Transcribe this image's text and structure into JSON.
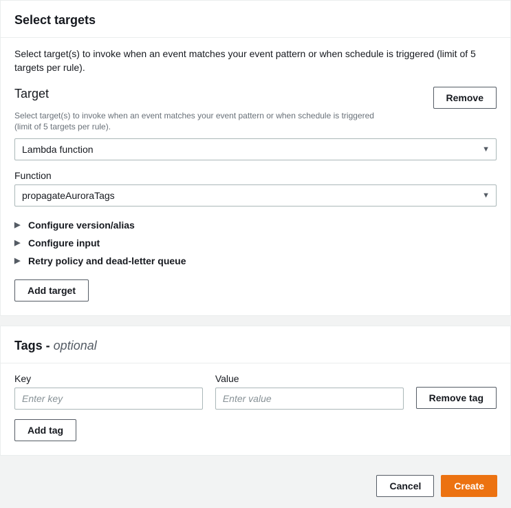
{
  "targets": {
    "panel_title": "Select targets",
    "intro": "Select target(s) to invoke when an event matches your event pattern or when schedule is triggered (limit of 5 targets per rule).",
    "target_label": "Target",
    "remove_button": "Remove",
    "target_helper": "Select target(s) to invoke when an event matches your event pattern or when schedule is triggered (limit of 5 targets per rule).",
    "target_select_value": "Lambda function",
    "function_label": "Function",
    "function_select_value": "propagateAuroraTags",
    "expandables": {
      "configure_version": "Configure version/alias",
      "configure_input": "Configure input",
      "retry_policy": "Retry policy and dead-letter queue"
    },
    "add_target_button": "Add target"
  },
  "tags": {
    "panel_title": "Tags - ",
    "panel_title_optional": "optional",
    "key_label": "Key",
    "key_placeholder": "Enter key",
    "value_label": "Value",
    "value_placeholder": "Enter value",
    "remove_tag_button": "Remove tag",
    "add_tag_button": "Add tag"
  },
  "footer": {
    "cancel": "Cancel",
    "create": "Create"
  }
}
